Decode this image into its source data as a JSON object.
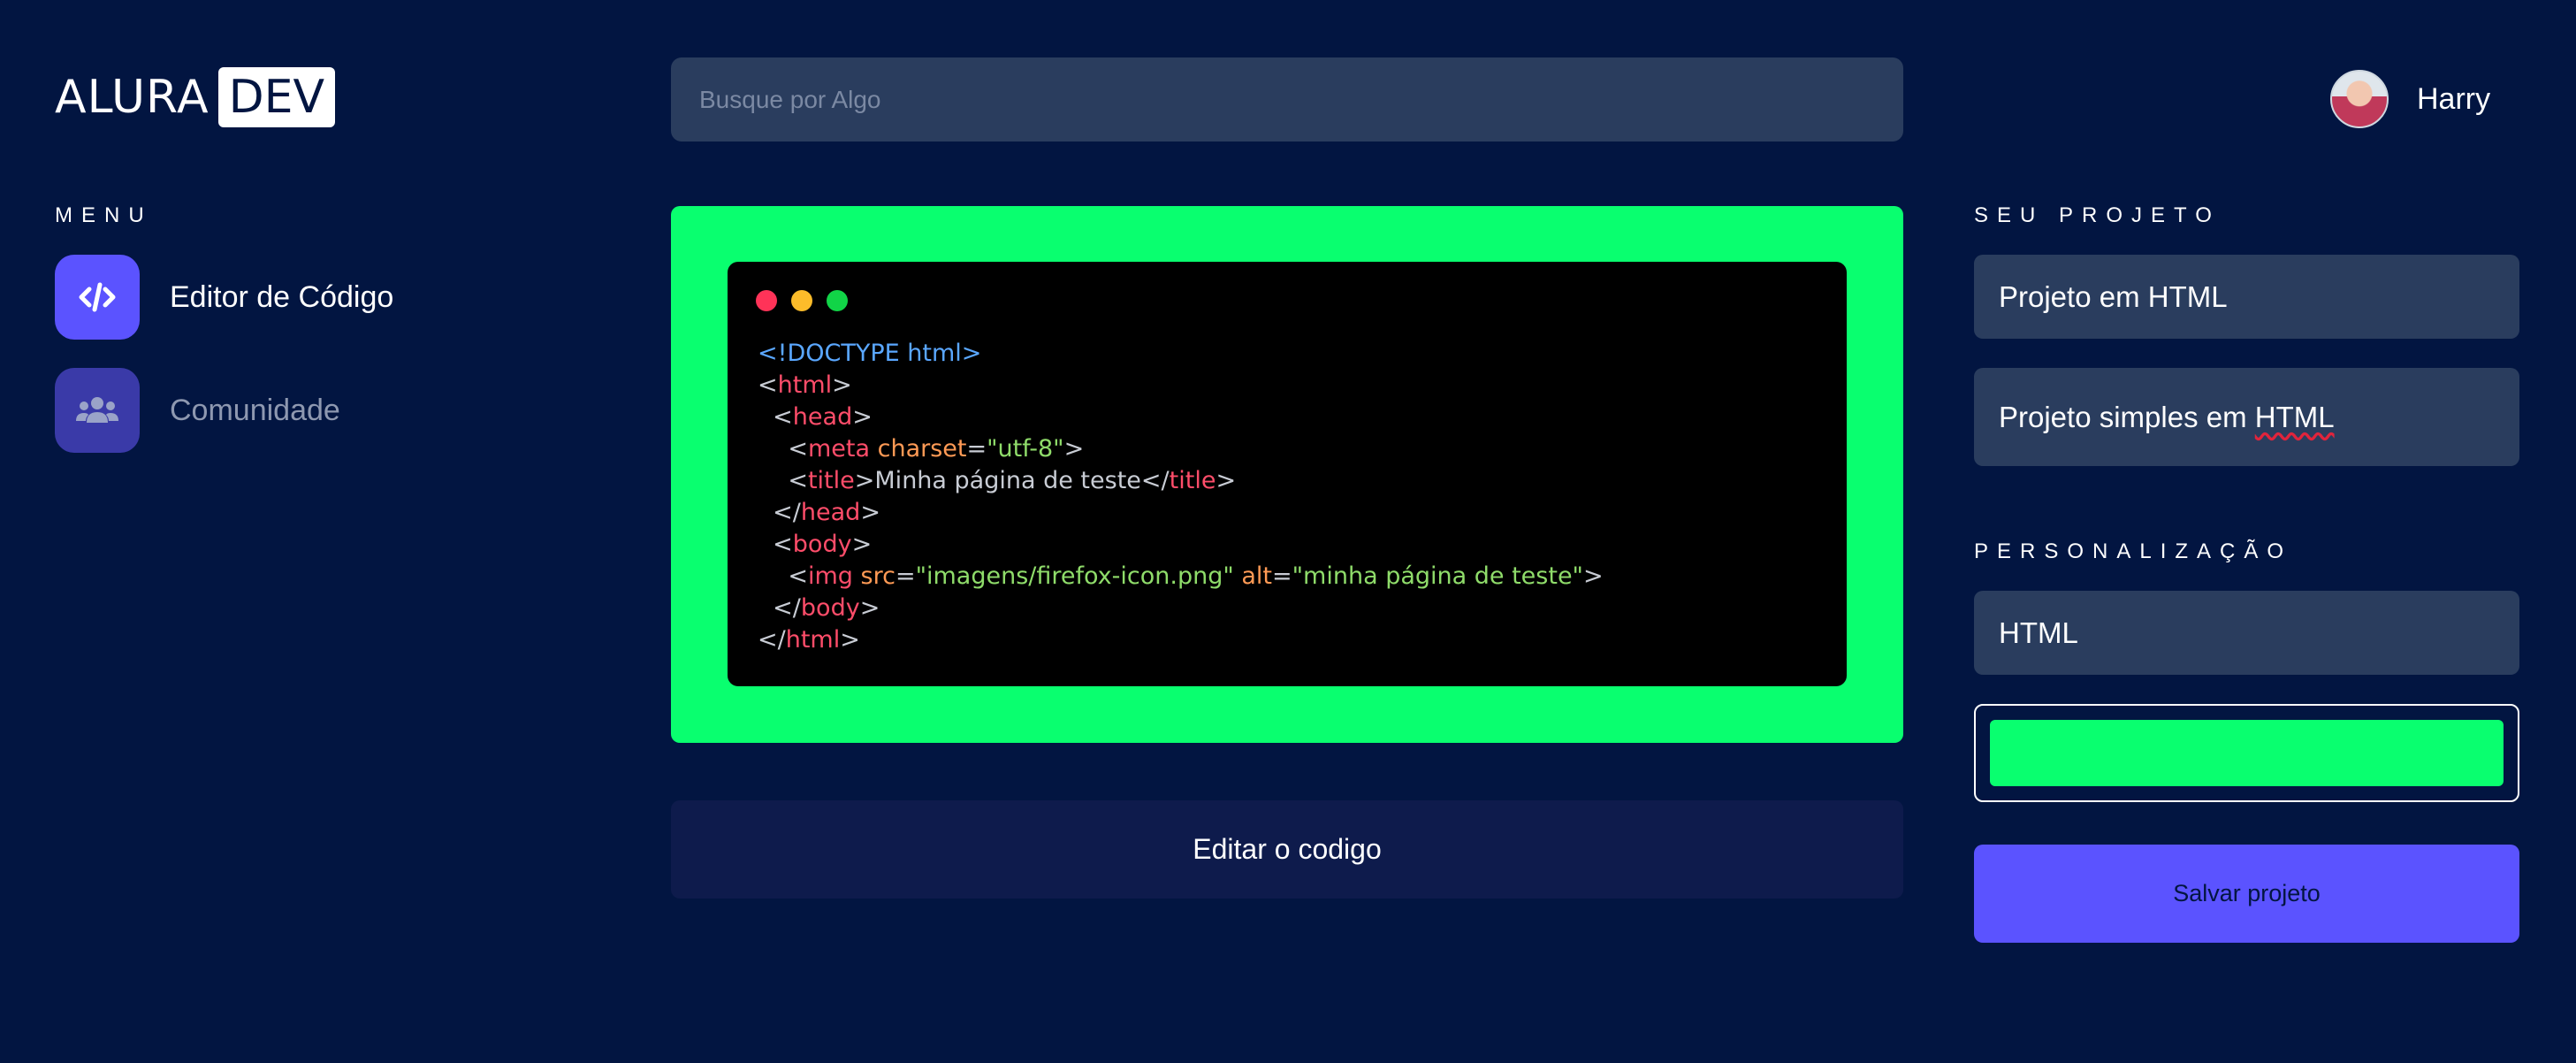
{
  "header": {
    "logo_text": "ALURA",
    "logo_badge": "DEV",
    "search_placeholder": "Busque por Algo",
    "user_name": "Harry"
  },
  "sidebar": {
    "menu_label": "MENU",
    "items": [
      {
        "label": "Editor de Código",
        "icon": "code-icon",
        "active": true
      },
      {
        "label": "Comunidade",
        "icon": "users-icon",
        "active": false
      }
    ]
  },
  "editor": {
    "frame_color": "#09ff6f",
    "code_lines": [
      "<!DOCTYPE html>",
      "<html>",
      "  <head>",
      "    <meta charset=\"utf-8\">",
      "    <title>Minha página de teste</title>",
      "  </head>",
      "  <body>",
      "    <img src=\"imagens/firefox-icon.png\" alt=\"minha página de teste\">",
      "  </body>",
      "</html>"
    ],
    "edit_button": "Editar o codigo"
  },
  "project": {
    "section_label": "SEU PROJETO",
    "name_value": "Projeto em HTML",
    "description_value": "Projeto simples em HTML"
  },
  "customization": {
    "section_label": "PERSONALIZAÇÃO",
    "language_value": "HTML",
    "color_value": "#09ff6f",
    "save_button": "Salvar projeto"
  },
  "colors": {
    "background": "#021541",
    "accent": "#5b53ff",
    "field": "#2a3d5e",
    "green": "#09ff6f"
  }
}
